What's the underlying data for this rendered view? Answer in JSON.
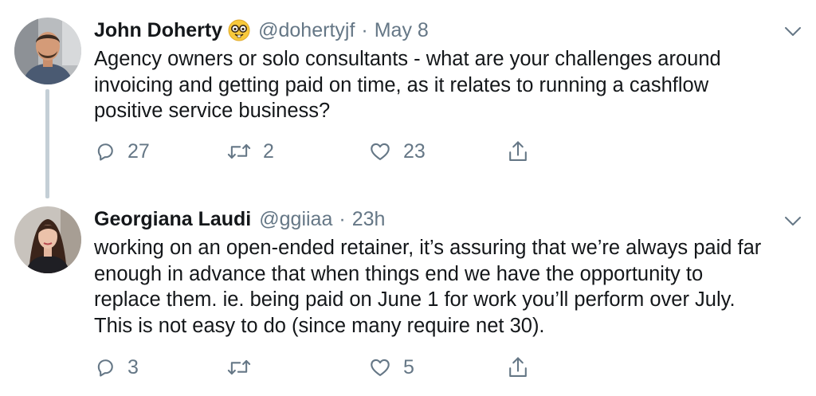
{
  "tweets": [
    {
      "display_name": "John Doherty",
      "emoji": "nerd-face-emoji",
      "handle": "@dohertyjf",
      "separator": "·",
      "time": "May 8",
      "text": "Agency owners or solo consultants - what are your challenges around\ninvoicing and getting paid on time, as it relates to running a cashflow\npositive service business?",
      "replies": "27",
      "retweets": "2",
      "likes": "23"
    },
    {
      "display_name": "Georgiana Laudi",
      "handle": "@ggiiaa",
      "separator": "·",
      "time": "23h",
      "text": "working on an open-ended retainer, it’s assuring that we’re always paid far\nenough in advance that when things end we have the opportunity to\nreplace them. ie. being paid on June 1 for work you’ll perform over July.\nThis is not easy to do (since many require net 30).",
      "replies": "3",
      "retweets": "",
      "likes": "5"
    }
  ],
  "icons": {
    "reply": "reply-icon",
    "retweet": "retweet-icon",
    "like": "heart-icon",
    "share": "share-icon",
    "more": "chevron-down-icon"
  },
  "colors": {
    "text": "#14171a",
    "muted": "#657786",
    "thread_line": "#c4cfd6"
  }
}
